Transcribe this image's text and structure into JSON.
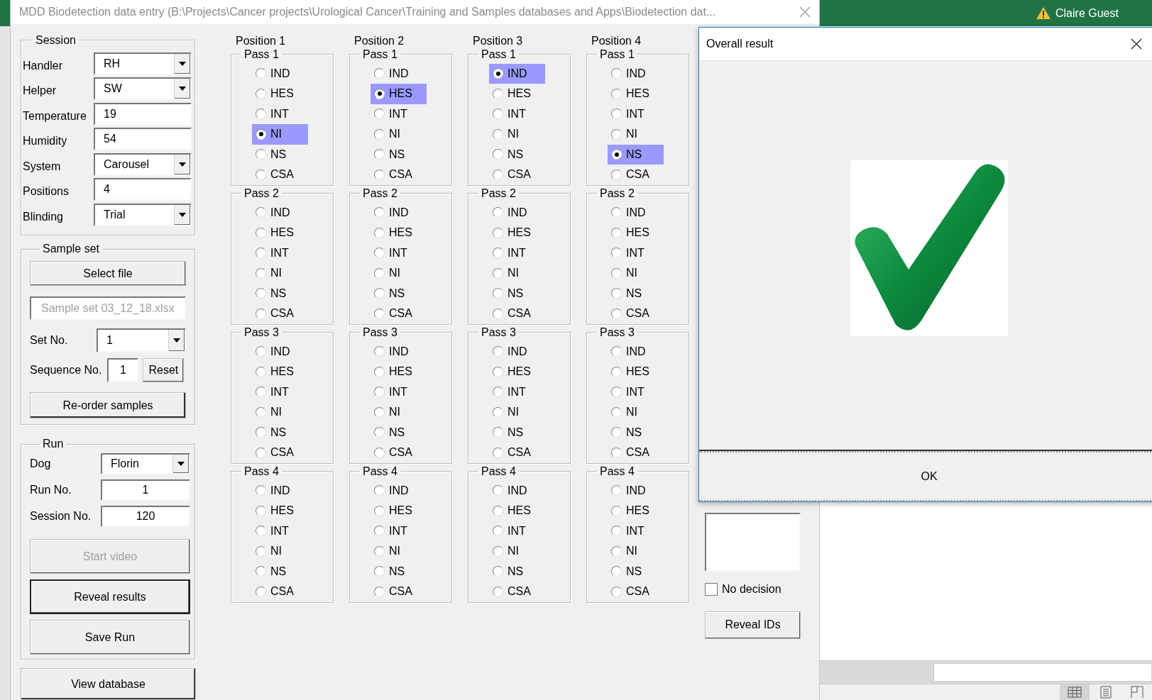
{
  "window": {
    "title": "MDD Biodetection data entry (B:\\Projects\\Cancer projects\\Urological Cancer\\Training and Samples databases and Apps\\Biodetection dat..."
  },
  "background_app": {
    "user": "Claire Guest"
  },
  "session": {
    "title": "Session",
    "fields": [
      {
        "label": "Handler",
        "value": "RH",
        "kind": "dropdown"
      },
      {
        "label": "Helper",
        "value": "SW",
        "kind": "dropdown"
      },
      {
        "label": "Temperature",
        "value": "19",
        "kind": "text"
      },
      {
        "label": "Humidity",
        "value": "54",
        "kind": "text"
      },
      {
        "label": "System",
        "value": "Carousel",
        "kind": "dropdown"
      },
      {
        "label": "Positions",
        "value": "4",
        "kind": "text"
      },
      {
        "label": "Blinding",
        "value": "Trial",
        "kind": "dropdown"
      }
    ]
  },
  "sample_set": {
    "title": "Sample set",
    "select_button": "Select file",
    "file": "Sample set 03_12_18.xlsx",
    "set_label": "Set No.",
    "set_value": "1",
    "sequence_label": "Sequence No.",
    "sequence_value": "1",
    "reset_button": "Reset",
    "reorder_button": "Re-order samples"
  },
  "run": {
    "title": "Run",
    "fields": [
      {
        "label": "Dog",
        "value": "Florin",
        "kind": "dropdown"
      },
      {
        "label": "Run No.",
        "value": "1",
        "kind": "text"
      },
      {
        "label": "Session No.",
        "value": "120",
        "kind": "text"
      }
    ],
    "buttons": [
      {
        "label": "Start video",
        "disabled": true,
        "default": false
      },
      {
        "label": "Reveal results",
        "disabled": false,
        "default": true
      },
      {
        "label": "Save Run",
        "disabled": false,
        "default": false
      }
    ]
  },
  "view_database_button": "View database",
  "positions": [
    {
      "title": "Position 1",
      "passes": [
        {
          "title": "Pass 1",
          "options": [
            {
              "label": "IND",
              "selected": false
            },
            {
              "label": "HES",
              "selected": false
            },
            {
              "label": "INT",
              "selected": false
            },
            {
              "label": "NI",
              "selected": true
            },
            {
              "label": "NS",
              "selected": false
            },
            {
              "label": "CSA",
              "selected": false
            }
          ]
        },
        {
          "title": "Pass 2",
          "options": [
            {
              "label": "IND",
              "selected": false
            },
            {
              "label": "HES",
              "selected": false
            },
            {
              "label": "INT",
              "selected": false
            },
            {
              "label": "NI",
              "selected": false
            },
            {
              "label": "NS",
              "selected": false
            },
            {
              "label": "CSA",
              "selected": false
            }
          ]
        },
        {
          "title": "Pass 3",
          "options": [
            {
              "label": "IND",
              "selected": false
            },
            {
              "label": "HES",
              "selected": false
            },
            {
              "label": "INT",
              "selected": false
            },
            {
              "label": "NI",
              "selected": false
            },
            {
              "label": "NS",
              "selected": false
            },
            {
              "label": "CSA",
              "selected": false
            }
          ]
        },
        {
          "title": "Pass 4",
          "options": [
            {
              "label": "IND",
              "selected": false
            },
            {
              "label": "HES",
              "selected": false
            },
            {
              "label": "INT",
              "selected": false
            },
            {
              "label": "NI",
              "selected": false
            },
            {
              "label": "NS",
              "selected": false
            },
            {
              "label": "CSA",
              "selected": false
            }
          ]
        }
      ]
    },
    {
      "title": "Position 2",
      "passes": [
        {
          "title": "Pass 1",
          "options": [
            {
              "label": "IND",
              "selected": false
            },
            {
              "label": "HES",
              "selected": true
            },
            {
              "label": "INT",
              "selected": false
            },
            {
              "label": "NI",
              "selected": false
            },
            {
              "label": "NS",
              "selected": false
            },
            {
              "label": "CSA",
              "selected": false
            }
          ]
        },
        {
          "title": "Pass 2",
          "options": [
            {
              "label": "IND",
              "selected": false
            },
            {
              "label": "HES",
              "selected": false
            },
            {
              "label": "INT",
              "selected": false
            },
            {
              "label": "NI",
              "selected": false
            },
            {
              "label": "NS",
              "selected": false
            },
            {
              "label": "CSA",
              "selected": false
            }
          ]
        },
        {
          "title": "Pass 3",
          "options": [
            {
              "label": "IND",
              "selected": false
            },
            {
              "label": "HES",
              "selected": false
            },
            {
              "label": "INT",
              "selected": false
            },
            {
              "label": "NI",
              "selected": false
            },
            {
              "label": "NS",
              "selected": false
            },
            {
              "label": "CSA",
              "selected": false
            }
          ]
        },
        {
          "title": "Pass 4",
          "options": [
            {
              "label": "IND",
              "selected": false
            },
            {
              "label": "HES",
              "selected": false
            },
            {
              "label": "INT",
              "selected": false
            },
            {
              "label": "NI",
              "selected": false
            },
            {
              "label": "NS",
              "selected": false
            },
            {
              "label": "CSA",
              "selected": false
            }
          ]
        }
      ]
    },
    {
      "title": "Position 3",
      "passes": [
        {
          "title": "Pass 1",
          "options": [
            {
              "label": "IND",
              "selected": true
            },
            {
              "label": "HES",
              "selected": false
            },
            {
              "label": "INT",
              "selected": false
            },
            {
              "label": "NI",
              "selected": false
            },
            {
              "label": "NS",
              "selected": false
            },
            {
              "label": "CSA",
              "selected": false
            }
          ]
        },
        {
          "title": "Pass 2",
          "options": [
            {
              "label": "IND",
              "selected": false
            },
            {
              "label": "HES",
              "selected": false
            },
            {
              "label": "INT",
              "selected": false
            },
            {
              "label": "NI",
              "selected": false
            },
            {
              "label": "NS",
              "selected": false
            },
            {
              "label": "CSA",
              "selected": false
            }
          ]
        },
        {
          "title": "Pass 3",
          "options": [
            {
              "label": "IND",
              "selected": false
            },
            {
              "label": "HES",
              "selected": false
            },
            {
              "label": "INT",
              "selected": false
            },
            {
              "label": "NI",
              "selected": false
            },
            {
              "label": "NS",
              "selected": false
            },
            {
              "label": "CSA",
              "selected": false
            }
          ]
        },
        {
          "title": "Pass 4",
          "options": [
            {
              "label": "IND",
              "selected": false
            },
            {
              "label": "HES",
              "selected": false
            },
            {
              "label": "INT",
              "selected": false
            },
            {
              "label": "NI",
              "selected": false
            },
            {
              "label": "NS",
              "selected": false
            },
            {
              "label": "CSA",
              "selected": false
            }
          ]
        }
      ]
    },
    {
      "title": "Position 4",
      "passes": [
        {
          "title": "Pass 1",
          "options": [
            {
              "label": "IND",
              "selected": false
            },
            {
              "label": "HES",
              "selected": false
            },
            {
              "label": "INT",
              "selected": false
            },
            {
              "label": "NI",
              "selected": false
            },
            {
              "label": "NS",
              "selected": true
            },
            {
              "label": "CSA",
              "selected": false
            }
          ]
        },
        {
          "title": "Pass 2",
          "options": [
            {
              "label": "IND",
              "selected": false
            },
            {
              "label": "HES",
              "selected": false
            },
            {
              "label": "INT",
              "selected": false
            },
            {
              "label": "NI",
              "selected": false
            },
            {
              "label": "NS",
              "selected": false
            },
            {
              "label": "CSA",
              "selected": false
            }
          ]
        },
        {
          "title": "Pass 3",
          "options": [
            {
              "label": "IND",
              "selected": false
            },
            {
              "label": "HES",
              "selected": false
            },
            {
              "label": "INT",
              "selected": false
            },
            {
              "label": "NI",
              "selected": false
            },
            {
              "label": "NS",
              "selected": false
            },
            {
              "label": "CSA",
              "selected": false
            }
          ]
        },
        {
          "title": "Pass 4",
          "options": [
            {
              "label": "IND",
              "selected": false
            },
            {
              "label": "HES",
              "selected": false
            },
            {
              "label": "INT",
              "selected": false
            },
            {
              "label": "NI",
              "selected": false
            },
            {
              "label": "NS",
              "selected": false
            },
            {
              "label": "CSA",
              "selected": false
            }
          ]
        }
      ]
    }
  ],
  "side": {
    "no_decision": {
      "label": "No decision",
      "checked": false
    },
    "reveal_button": "Reveal IDs"
  },
  "dialog": {
    "title": "Overall result",
    "ok_button": "OK"
  }
}
